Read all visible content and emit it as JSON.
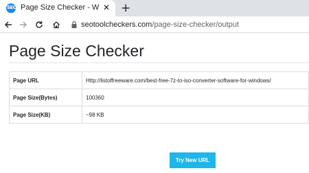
{
  "browser": {
    "tab_title": "Page Size Checker - Website Page",
    "favicon_text": "SEO",
    "close_glyph": "✕",
    "new_tab_glyph": "+",
    "url_host": "seotoolcheckers.com",
    "url_path": "/page-size-checker/output"
  },
  "page": {
    "title": "Page Size Checker",
    "rows": [
      {
        "label": "Page URL",
        "value": "Http://listoffreeware.com/best-free-7z-to-iso-converter-software-for-windows/"
      },
      {
        "label": "Page Size(Bytes)",
        "value": "100360"
      },
      {
        "label": "Page Size(KB)",
        "value": "~98 KB"
      }
    ],
    "button_label": "Try New URL",
    "button_color": "#1fb6e8"
  }
}
